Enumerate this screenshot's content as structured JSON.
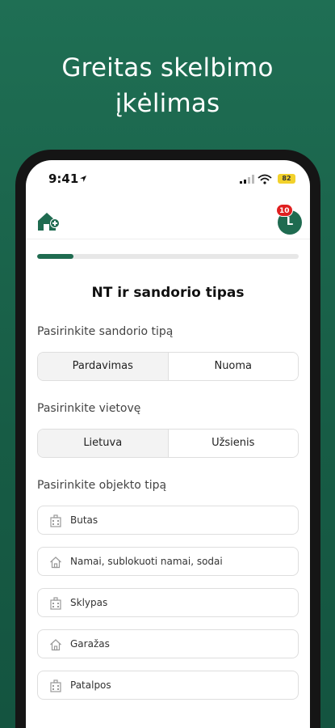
{
  "hero": {
    "line1": "Greitas skelbimo",
    "line2": "įkėlimas"
  },
  "status_bar": {
    "time": "9:41",
    "battery": "82"
  },
  "header": {
    "avatar_initial": "L",
    "notification_count": "10"
  },
  "progress": {
    "fraction": 0.14
  },
  "form": {
    "title": "NT ir sandorio tipas",
    "transaction": {
      "label": "Pasirinkite sandorio tipą",
      "options": [
        "Pardavimas",
        "Nuoma"
      ],
      "selected": "Pardavimas"
    },
    "location": {
      "label": "Pasirinkite vietovę",
      "options": [
        "Lietuva",
        "Užsienis"
      ],
      "selected": "Lietuva"
    },
    "object": {
      "label": "Pasirinkite objekto tipą",
      "items": [
        {
          "label": "Butas",
          "icon": "apartment-icon"
        },
        {
          "label": "Namai, sublokuoti namai, sodai",
          "icon": "house-icon"
        },
        {
          "label": "Sklypas",
          "icon": "plot-icon"
        },
        {
          "label": "Garažas",
          "icon": "garage-icon"
        },
        {
          "label": "Patalpos",
          "icon": "premises-icon"
        }
      ]
    }
  },
  "colors": {
    "brand": "#1f6b50",
    "badge": "#e02020",
    "background": "#1a644c"
  }
}
